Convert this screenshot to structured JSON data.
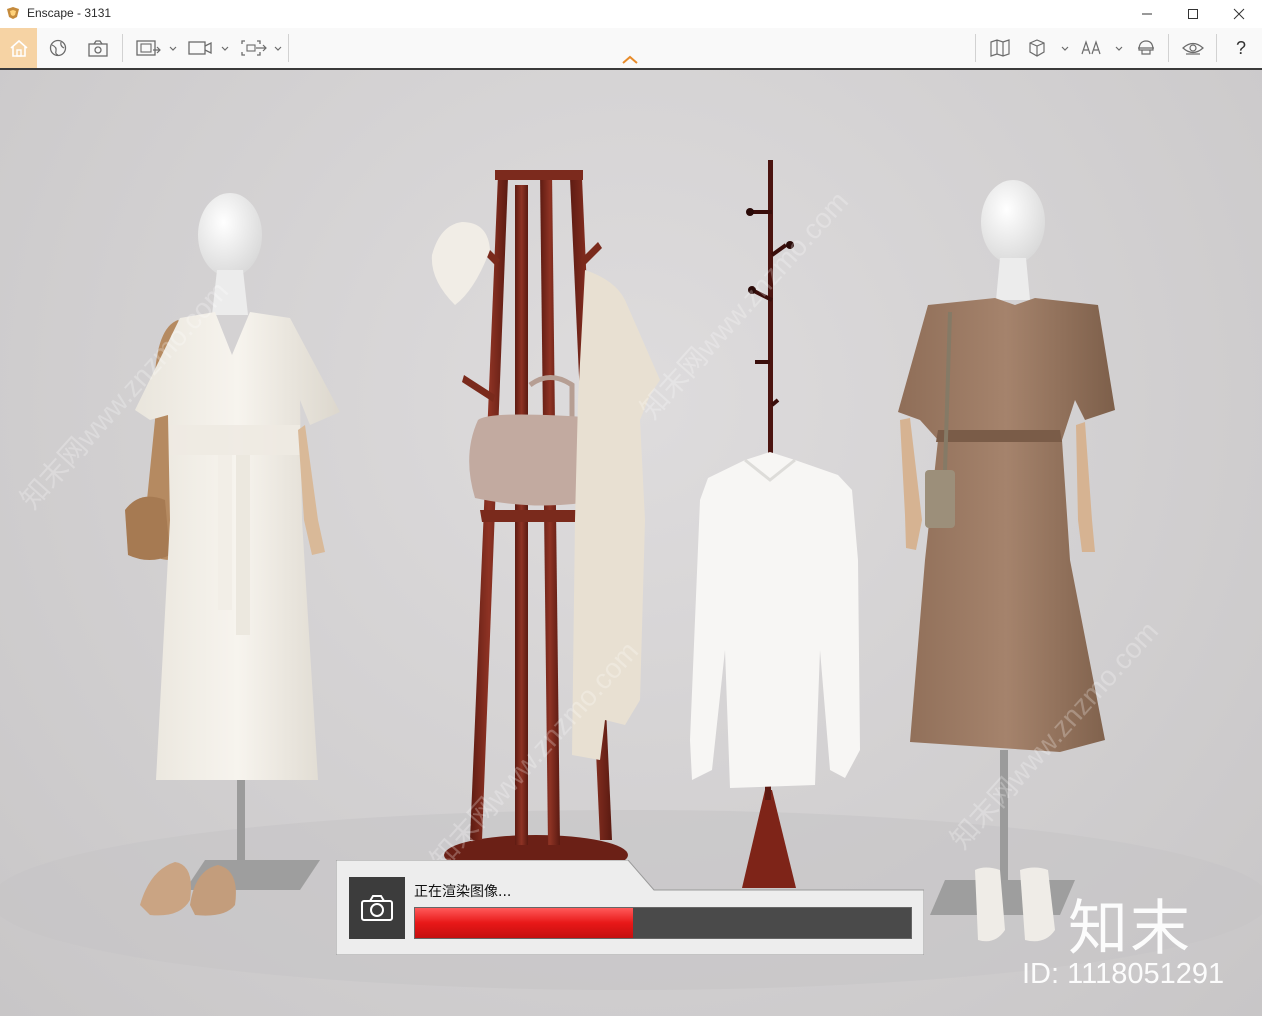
{
  "window": {
    "title": "Enscape - 3131",
    "controls": {
      "minimize_icon": "minimize-icon",
      "maximize_icon": "maximize-icon",
      "close_icon": "close-icon"
    }
  },
  "toolbar": {
    "left": [
      {
        "name": "home-button",
        "icon": "home-icon",
        "active": true
      },
      {
        "name": "orbit-view-button",
        "icon": "globe-icon"
      },
      {
        "name": "settings-capture-button",
        "icon": "camera-settings-icon"
      },
      {
        "name": "screenshot-button",
        "icon": "screenshot-icon",
        "dropdown": true
      },
      {
        "name": "video-button",
        "icon": "video-icon",
        "dropdown": true
      },
      {
        "name": "export-button",
        "icon": "export-icon",
        "dropdown": true
      }
    ],
    "right": [
      {
        "name": "map-button",
        "icon": "map-icon"
      },
      {
        "name": "asset-library-button",
        "icon": "cube-icon",
        "dropdown": true
      },
      {
        "name": "vr-button",
        "icon": "vr-icon",
        "dropdown": true
      },
      {
        "name": "feedback-button",
        "icon": "helmet-icon"
      },
      {
        "name": "view-button",
        "icon": "eye-icon"
      },
      {
        "name": "help-button",
        "label": "?"
      }
    ],
    "collapse_icon": "chevron-up-icon",
    "accent": "#f6d3a4",
    "caret_color": "#e78b2a"
  },
  "render": {
    "label": "正在渲染图像...",
    "progress": 0.44,
    "camera_icon": "camera-icon",
    "bar_color": "#e81818"
  },
  "watermark": {
    "logo": "知末",
    "id_text": "ID: 1118051291",
    "diagonal_text": "知末网www.znzmo.com"
  }
}
